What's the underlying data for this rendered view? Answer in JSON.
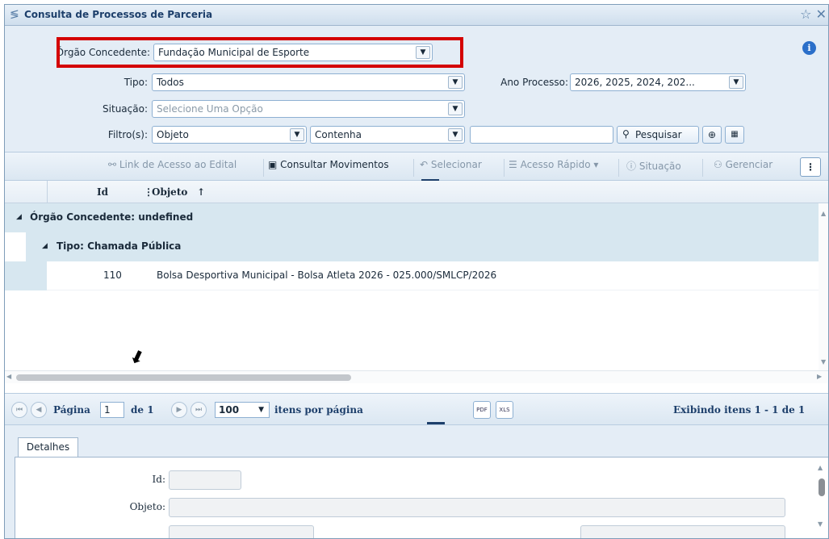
{
  "window": {
    "title": "Consulta de Processos de Parceria"
  },
  "filters": {
    "orgao_label": "Órgão Concedente:",
    "orgao_value": "Fundação Municipal de Esporte",
    "tipo_label": "Tipo:",
    "tipo_value": "Todos",
    "ano_label": "Ano Processo:",
    "ano_value": "2026, 2025, 2024, 202...",
    "situacao_label": "Situação:",
    "situacao_placeholder": "Selecione Uma Opção",
    "filtro_label": "Filtro(s):",
    "filtro_field": "Objeto",
    "filtro_op": "Contenha",
    "filtro_text": "",
    "search_label": "Pesquisar"
  },
  "toolbar": {
    "link_acesso": "Link de Acesso ao Edital",
    "consultar": "Consultar Movimentos",
    "selecionar": "Selecionar",
    "acesso_rapido": "Acesso Rápido",
    "situacao": "Situação",
    "gerenciar": "Gerenciar",
    "more": "⋮"
  },
  "grid": {
    "columns": [
      "Id",
      "Objeto"
    ],
    "group1": "Órgão Concedente: undefined",
    "group2": "Tipo: Chamada Pública",
    "rows": [
      {
        "id": "110",
        "objeto": "Bolsa Desportiva Municipal - Bolsa Atleta 2026 - 025.000/SMLCP/2026"
      }
    ]
  },
  "pager": {
    "pagina_label": "Página",
    "page": "1",
    "de_label": "de 1",
    "per_page": "100",
    "itens_label": "itens por página",
    "exibindo": "Exibindo itens 1 - 1 de 1"
  },
  "details": {
    "tab": "Detalhes",
    "id_label": "Id:",
    "objeto_label": "Objeto:"
  }
}
